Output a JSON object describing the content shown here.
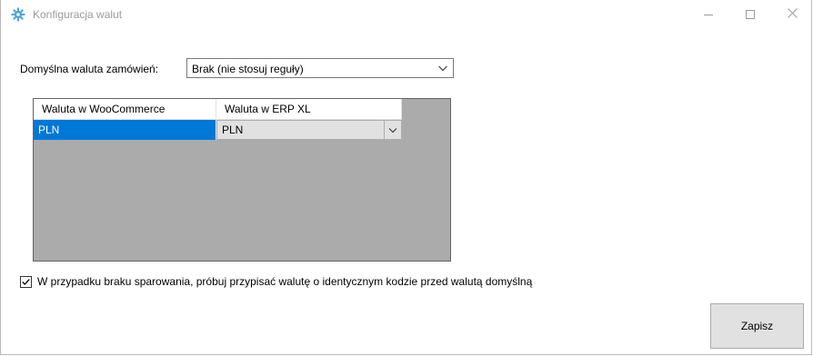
{
  "window": {
    "title": "Konfiguracja walut",
    "app_icon": "gear-icon",
    "controls": [
      "minimize-icon",
      "maximize-icon",
      "close-icon"
    ]
  },
  "default_currency": {
    "label": "Domyślna waluta zamówień:",
    "selected": "Brak (nie stosuj reguły)"
  },
  "grid": {
    "columns": [
      "Waluta w WooCommerce",
      "Waluta w ERP XL"
    ],
    "rows": [
      {
        "woocommerce": "PLN",
        "erp_xl": "PLN"
      }
    ]
  },
  "fallback_option": {
    "label": "W przypadku braku sparowania, próbuj przypisać walutę o identycznym kodzie przed walutą domyślną",
    "checked": true
  },
  "actions": {
    "save_label": "Zapisz"
  },
  "colors": {
    "selection": "#0078d7",
    "grid_background": "#ababab",
    "button_face": "#e1e1e1",
    "app_icon": "#4aa3df"
  }
}
